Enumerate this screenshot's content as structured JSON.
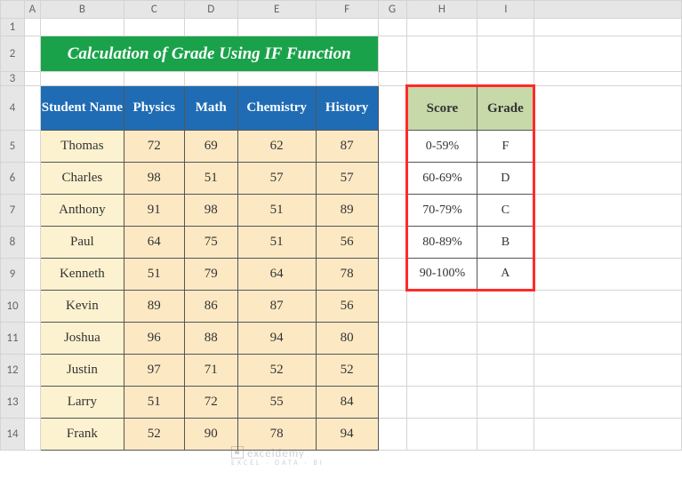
{
  "cols": [
    "A",
    "B",
    "C",
    "D",
    "E",
    "F",
    "G",
    "H",
    "I"
  ],
  "rows": [
    "1",
    "2",
    "3",
    "4",
    "5",
    "6",
    "7",
    "8",
    "9",
    "10",
    "11",
    "12",
    "13",
    "14"
  ],
  "title": "Calculation of Grade Using IF Function",
  "main_headers": {
    "name": "Student Name",
    "c1": "Physics",
    "c2": "Math",
    "c3": "Chemistry",
    "c4": "History"
  },
  "students": [
    {
      "name": "Thomas",
      "s": [
        "72",
        "69",
        "62",
        "87"
      ]
    },
    {
      "name": "Charles",
      "s": [
        "98",
        "51",
        "57",
        "57"
      ]
    },
    {
      "name": "Anthony",
      "s": [
        "91",
        "98",
        "51",
        "89"
      ]
    },
    {
      "name": "Paul",
      "s": [
        "64",
        "75",
        "51",
        "56"
      ]
    },
    {
      "name": "Kenneth",
      "s": [
        "51",
        "79",
        "64",
        "78"
      ]
    },
    {
      "name": "Kevin",
      "s": [
        "89",
        "86",
        "87",
        "56"
      ]
    },
    {
      "name": "Joshua",
      "s": [
        "96",
        "88",
        "94",
        "80"
      ]
    },
    {
      "name": "Justin",
      "s": [
        "97",
        "71",
        "52",
        "52"
      ]
    },
    {
      "name": "Larry",
      "s": [
        "51",
        "72",
        "55",
        "84"
      ]
    },
    {
      "name": "Frank",
      "s": [
        "52",
        "90",
        "78",
        "94"
      ]
    }
  ],
  "grade_header": {
    "score": "Score",
    "grade": "Grade"
  },
  "grades": [
    {
      "range": "0-59%",
      "letter": "F"
    },
    {
      "range": "60-69%",
      "letter": "D"
    },
    {
      "range": "70-79%",
      "letter": "C"
    },
    {
      "range": "80-89%",
      "letter": "B"
    },
    {
      "range": "90-100%",
      "letter": "A"
    }
  ],
  "watermark": {
    "brand": "exceldemy",
    "tag": "EXCEL · DATA · BI"
  },
  "chart_data": {
    "type": "table",
    "title": "Calculation of Grade Using IF Function",
    "columns": [
      "Student Name",
      "Physics",
      "Math",
      "Chemistry",
      "History"
    ],
    "rows": [
      [
        "Thomas",
        72,
        69,
        62,
        87
      ],
      [
        "Charles",
        98,
        51,
        57,
        57
      ],
      [
        "Anthony",
        91,
        98,
        51,
        89
      ],
      [
        "Paul",
        64,
        75,
        51,
        56
      ],
      [
        "Kenneth",
        51,
        79,
        64,
        78
      ],
      [
        "Kevin",
        89,
        86,
        87,
        56
      ],
      [
        "Joshua",
        96,
        88,
        94,
        80
      ],
      [
        "Justin",
        97,
        71,
        52,
        52
      ],
      [
        "Larry",
        51,
        72,
        55,
        84
      ],
      [
        "Frank",
        52,
        90,
        78,
        94
      ]
    ],
    "grade_scale": [
      {
        "range": "0-59%",
        "grade": "F"
      },
      {
        "range": "60-69%",
        "grade": "D"
      },
      {
        "range": "70-79%",
        "grade": "C"
      },
      {
        "range": "80-89%",
        "grade": "B"
      },
      {
        "range": "90-100%",
        "grade": "A"
      }
    ]
  }
}
